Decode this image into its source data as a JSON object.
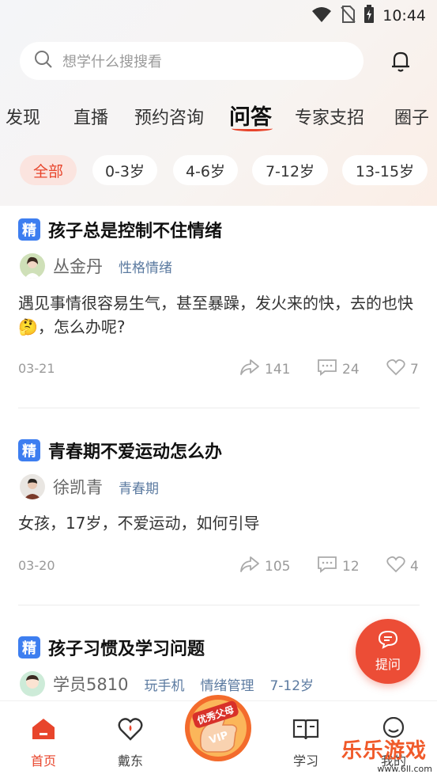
{
  "status_bar": {
    "time": "10:44"
  },
  "search": {
    "placeholder": "想学什么搜搜看"
  },
  "tabs": [
    {
      "label": "发现"
    },
    {
      "label": "直播"
    },
    {
      "label": "预约咨询"
    },
    {
      "label": "问答",
      "active": true
    },
    {
      "label": "专家支招"
    },
    {
      "label": "圈子"
    }
  ],
  "filters": [
    {
      "label": "全部",
      "active": true
    },
    {
      "label": "0-3岁"
    },
    {
      "label": "4-6岁"
    },
    {
      "label": "7-12岁"
    },
    {
      "label": "13-15岁"
    }
  ],
  "questions": [
    {
      "badge": "精",
      "title": "孩子总是控制不住情绪",
      "author": "丛金丹",
      "tags": [
        "性格情绪"
      ],
      "body": "遇见事情很容易生气，甚至暴躁，发火来的快，去的也快🤔，怎么办呢?",
      "date": "03-21",
      "shares": "141",
      "comments": "24",
      "likes": "7"
    },
    {
      "badge": "精",
      "title": "青春期不爱运动怎么办",
      "author": "徐凯青",
      "tags": [
        "青春期"
      ],
      "body": "女孩，17岁，不爱运动，如何引导",
      "date": "03-20",
      "shares": "105",
      "comments": "12",
      "likes": "4"
    },
    {
      "badge": "精",
      "title": "孩子习惯及学习问题",
      "author": "学员5810",
      "tags": [
        "玩手机",
        "情绪管理",
        "7-12岁"
      ]
    }
  ],
  "fab": {
    "label": "提问"
  },
  "bottom_nav": [
    {
      "label": "首页",
      "active": true,
      "icon": "home-icon"
    },
    {
      "label": "戴东",
      "icon": "heart-drop-icon"
    },
    {
      "label": "学习",
      "icon": "book-icon"
    },
    {
      "label": "我的",
      "icon": "profile-icon"
    }
  ],
  "vip_badge": {
    "text": "优秀父母",
    "sub": "VIP"
  },
  "watermark": {
    "text": "乐乐游戏",
    "url": "www.6ll.com"
  },
  "colors": {
    "accent": "#e8452c",
    "badge_blue": "#3d7ef0",
    "tag_blue": "#5b7aa0"
  }
}
